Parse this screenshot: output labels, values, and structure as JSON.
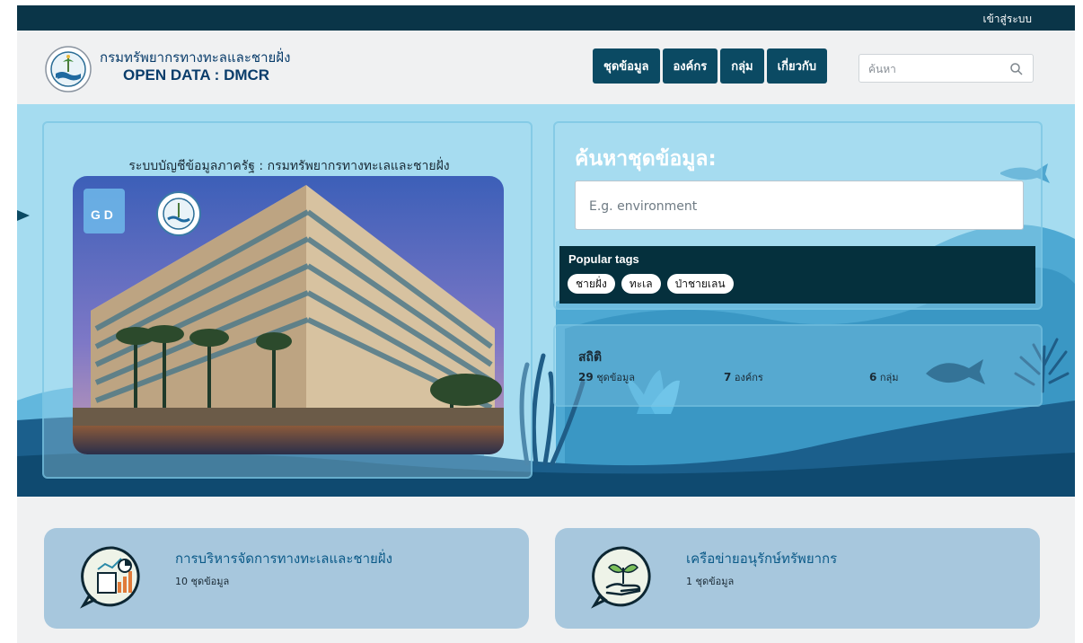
{
  "topbar": {
    "login_label": "เข้าสู่ระบบ"
  },
  "header": {
    "title": "กรมทรัพยากรทางทะลและชายฝั่ง",
    "subtitle": "OPEN DATA : DMCR",
    "nav": [
      {
        "label": "ชุดข้อมูล"
      },
      {
        "label": "องค์กร"
      },
      {
        "label": "กลุ่ม"
      },
      {
        "label": "เกี่ยวกับ"
      }
    ],
    "search_placeholder": "ค้นหา"
  },
  "hero": {
    "left_title": "ระบบบัญชีข้อมูลภาครัฐ : กรมทรัพยากรทางทะเลและชายฝั่ง",
    "gd_badge_text": "G D",
    "search_heading": "ค้นหาชุดข้อมูล:",
    "search_placeholder": "E.g. environment",
    "popular_tags_title": "Popular tags",
    "tags": [
      {
        "label": "ชายฝั่ง"
      },
      {
        "label": "ทะเล"
      },
      {
        "label": "ป่าชายเลน"
      }
    ],
    "stats_title": "สถิติ",
    "stats": [
      {
        "value": "29",
        "label": "ชุดข้อมูล"
      },
      {
        "value": "7",
        "label": "องค์กร"
      },
      {
        "value": "6",
        "label": "กลุ่ม"
      }
    ]
  },
  "categories": [
    {
      "title": "การบริหารจัดการทางทะเลและชายฝั่ง",
      "count": "10 ชุดข้อมูล",
      "icon": "chart-report-icon"
    },
    {
      "title": "เครือข่ายอนุรักษ์ทรัพยากร",
      "count": "1 ชุดข้อมูล",
      "icon": "plant-hand-icon"
    }
  ],
  "colors": {
    "topbar": "#0a3548",
    "nav_button": "#0b4a63",
    "hero_sky": "#a5dcf0",
    "tags_box": "#05303d",
    "category_card": "#a7c7dd",
    "title_blue": "#0a3d6b"
  }
}
